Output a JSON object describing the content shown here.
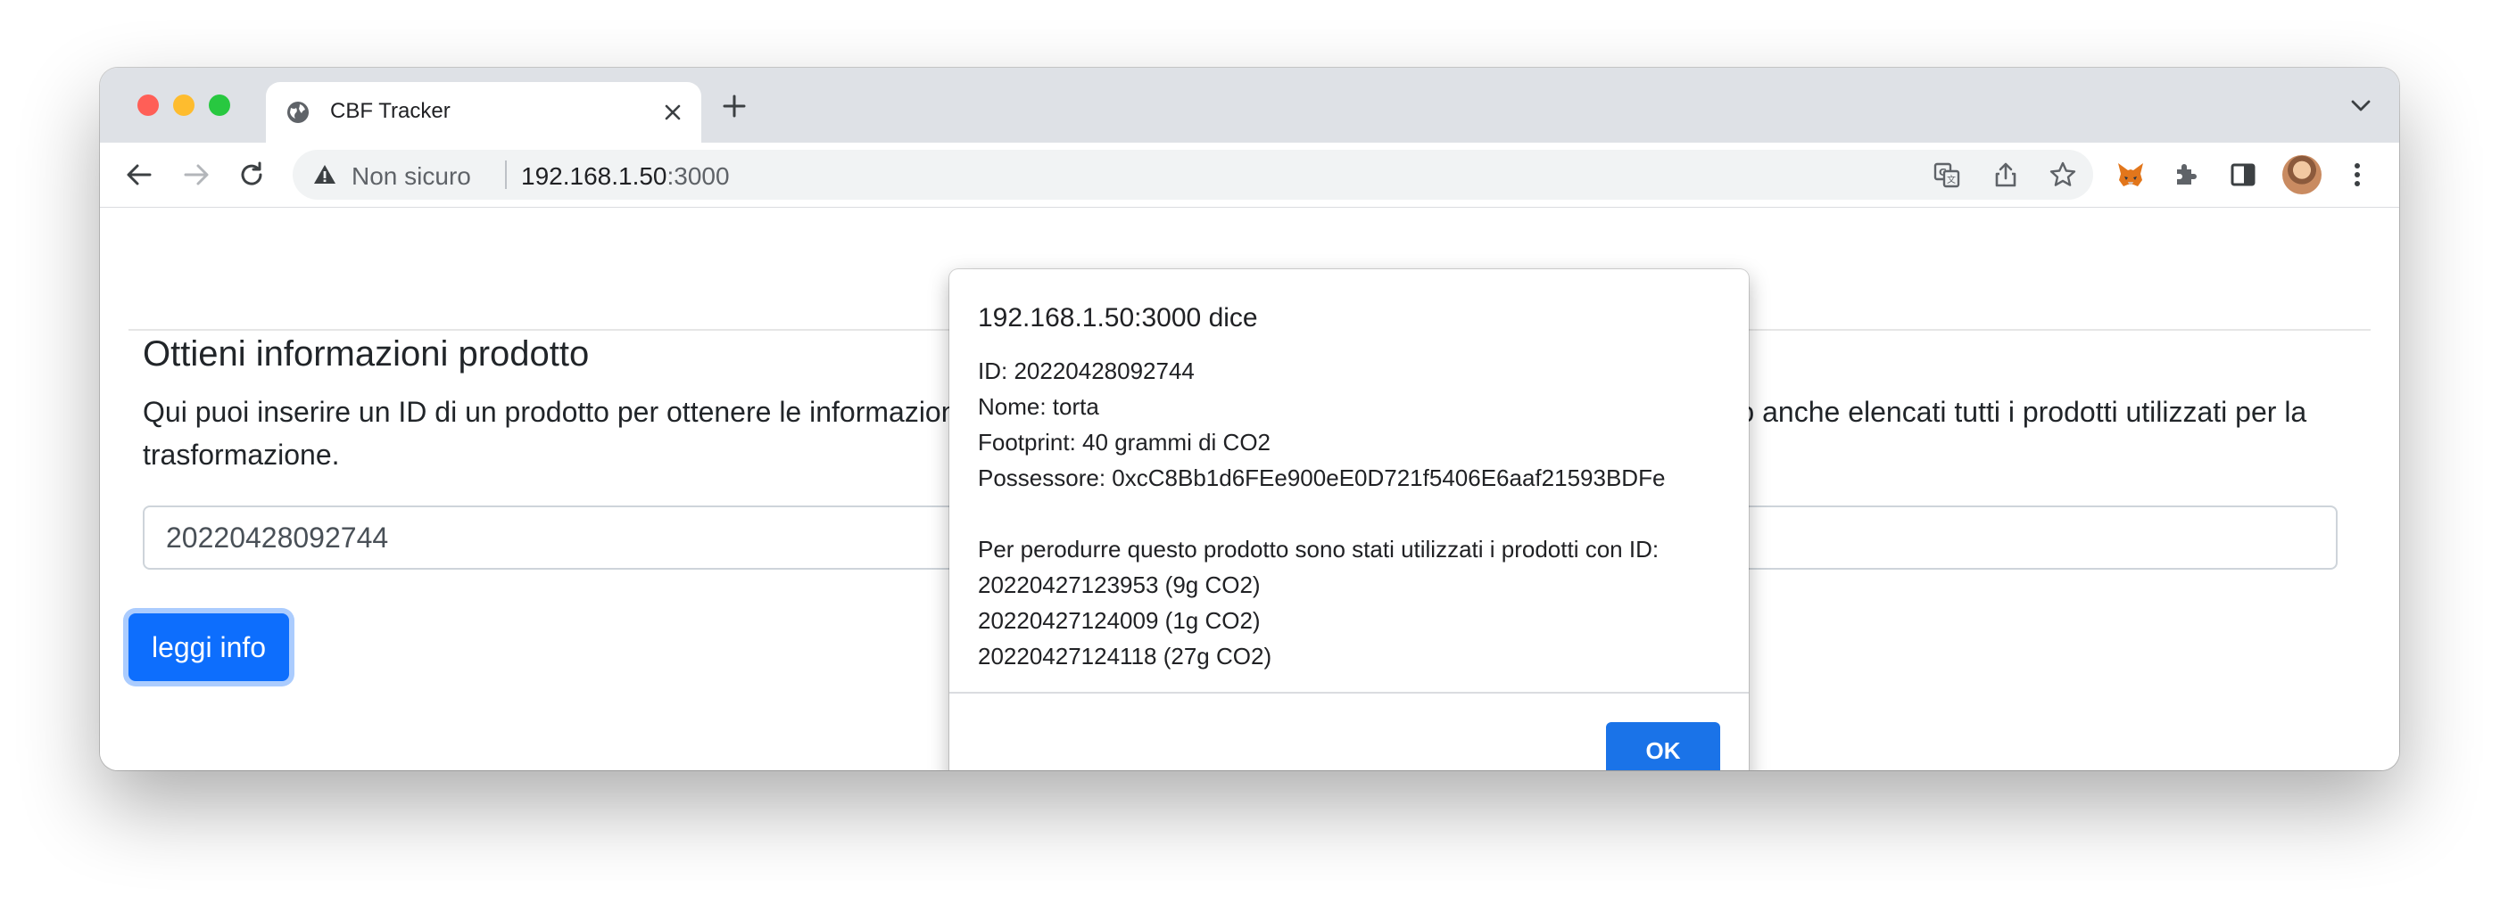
{
  "browser": {
    "tab_title": "CBF Tracker",
    "security_label": "Non sicuro",
    "url_host": "192.168.1.50",
    "url_port": ":3000"
  },
  "page": {
    "section_title": "Ottieni informazioni prodotto",
    "description": "Qui puoi inserire un ID di un prodotto per ottenere le informazioni associate. Se l'ID è quello di un prodotto trasformato verranno anche elencati tutti i prodotti utilizzati per la trasformazione.",
    "input_value": "20220428092744",
    "button_label": "leggi info"
  },
  "dialog": {
    "title": "192.168.1.50:3000 dice",
    "lines": [
      "ID: 20220428092744",
      "Nome: torta",
      "Footprint: 40 grammi di CO2",
      "Possessore: 0xcC8Bb1d6FEe900eE0D721f5406E6aaf21593BDFe",
      "",
      "Per perodurre questo prodotto sono stati utilizzati i prodotti con ID:",
      "20220427123953 (9g CO2)",
      "20220427124009 (1g CO2)",
      "20220427124118 (27g CO2)"
    ],
    "ok_label": "OK"
  }
}
